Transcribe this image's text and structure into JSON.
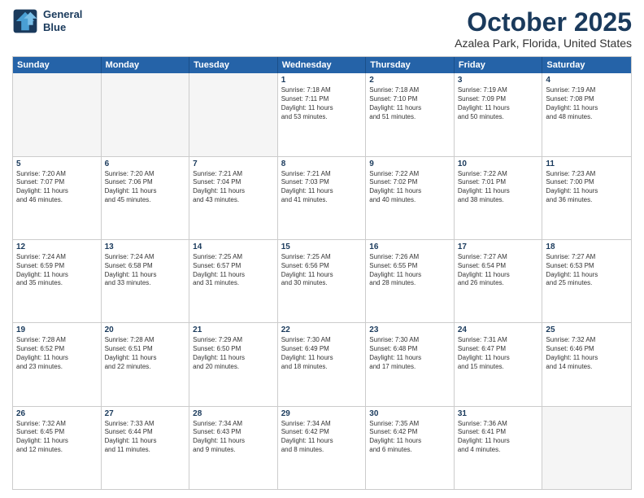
{
  "header": {
    "logo_line1": "General",
    "logo_line2": "Blue",
    "month": "October 2025",
    "location": "Azalea Park, Florida, United States"
  },
  "day_headers": [
    "Sunday",
    "Monday",
    "Tuesday",
    "Wednesday",
    "Thursday",
    "Friday",
    "Saturday"
  ],
  "weeks": [
    [
      {
        "num": "",
        "empty": true,
        "lines": []
      },
      {
        "num": "",
        "empty": true,
        "lines": []
      },
      {
        "num": "",
        "empty": true,
        "lines": []
      },
      {
        "num": "1",
        "empty": false,
        "lines": [
          "Sunrise: 7:18 AM",
          "Sunset: 7:11 PM",
          "Daylight: 11 hours",
          "and 53 minutes."
        ]
      },
      {
        "num": "2",
        "empty": false,
        "lines": [
          "Sunrise: 7:18 AM",
          "Sunset: 7:10 PM",
          "Daylight: 11 hours",
          "and 51 minutes."
        ]
      },
      {
        "num": "3",
        "empty": false,
        "lines": [
          "Sunrise: 7:19 AM",
          "Sunset: 7:09 PM",
          "Daylight: 11 hours",
          "and 50 minutes."
        ]
      },
      {
        "num": "4",
        "empty": false,
        "lines": [
          "Sunrise: 7:19 AM",
          "Sunset: 7:08 PM",
          "Daylight: 11 hours",
          "and 48 minutes."
        ]
      }
    ],
    [
      {
        "num": "5",
        "empty": false,
        "lines": [
          "Sunrise: 7:20 AM",
          "Sunset: 7:07 PM",
          "Daylight: 11 hours",
          "and 46 minutes."
        ]
      },
      {
        "num": "6",
        "empty": false,
        "lines": [
          "Sunrise: 7:20 AM",
          "Sunset: 7:06 PM",
          "Daylight: 11 hours",
          "and 45 minutes."
        ]
      },
      {
        "num": "7",
        "empty": false,
        "lines": [
          "Sunrise: 7:21 AM",
          "Sunset: 7:04 PM",
          "Daylight: 11 hours",
          "and 43 minutes."
        ]
      },
      {
        "num": "8",
        "empty": false,
        "lines": [
          "Sunrise: 7:21 AM",
          "Sunset: 7:03 PM",
          "Daylight: 11 hours",
          "and 41 minutes."
        ]
      },
      {
        "num": "9",
        "empty": false,
        "lines": [
          "Sunrise: 7:22 AM",
          "Sunset: 7:02 PM",
          "Daylight: 11 hours",
          "and 40 minutes."
        ]
      },
      {
        "num": "10",
        "empty": false,
        "lines": [
          "Sunrise: 7:22 AM",
          "Sunset: 7:01 PM",
          "Daylight: 11 hours",
          "and 38 minutes."
        ]
      },
      {
        "num": "11",
        "empty": false,
        "lines": [
          "Sunrise: 7:23 AM",
          "Sunset: 7:00 PM",
          "Daylight: 11 hours",
          "and 36 minutes."
        ]
      }
    ],
    [
      {
        "num": "12",
        "empty": false,
        "lines": [
          "Sunrise: 7:24 AM",
          "Sunset: 6:59 PM",
          "Daylight: 11 hours",
          "and 35 minutes."
        ]
      },
      {
        "num": "13",
        "empty": false,
        "lines": [
          "Sunrise: 7:24 AM",
          "Sunset: 6:58 PM",
          "Daylight: 11 hours",
          "and 33 minutes."
        ]
      },
      {
        "num": "14",
        "empty": false,
        "lines": [
          "Sunrise: 7:25 AM",
          "Sunset: 6:57 PM",
          "Daylight: 11 hours",
          "and 31 minutes."
        ]
      },
      {
        "num": "15",
        "empty": false,
        "lines": [
          "Sunrise: 7:25 AM",
          "Sunset: 6:56 PM",
          "Daylight: 11 hours",
          "and 30 minutes."
        ]
      },
      {
        "num": "16",
        "empty": false,
        "lines": [
          "Sunrise: 7:26 AM",
          "Sunset: 6:55 PM",
          "Daylight: 11 hours",
          "and 28 minutes."
        ]
      },
      {
        "num": "17",
        "empty": false,
        "lines": [
          "Sunrise: 7:27 AM",
          "Sunset: 6:54 PM",
          "Daylight: 11 hours",
          "and 26 minutes."
        ]
      },
      {
        "num": "18",
        "empty": false,
        "lines": [
          "Sunrise: 7:27 AM",
          "Sunset: 6:53 PM",
          "Daylight: 11 hours",
          "and 25 minutes."
        ]
      }
    ],
    [
      {
        "num": "19",
        "empty": false,
        "lines": [
          "Sunrise: 7:28 AM",
          "Sunset: 6:52 PM",
          "Daylight: 11 hours",
          "and 23 minutes."
        ]
      },
      {
        "num": "20",
        "empty": false,
        "lines": [
          "Sunrise: 7:28 AM",
          "Sunset: 6:51 PM",
          "Daylight: 11 hours",
          "and 22 minutes."
        ]
      },
      {
        "num": "21",
        "empty": false,
        "lines": [
          "Sunrise: 7:29 AM",
          "Sunset: 6:50 PM",
          "Daylight: 11 hours",
          "and 20 minutes."
        ]
      },
      {
        "num": "22",
        "empty": false,
        "lines": [
          "Sunrise: 7:30 AM",
          "Sunset: 6:49 PM",
          "Daylight: 11 hours",
          "and 18 minutes."
        ]
      },
      {
        "num": "23",
        "empty": false,
        "lines": [
          "Sunrise: 7:30 AM",
          "Sunset: 6:48 PM",
          "Daylight: 11 hours",
          "and 17 minutes."
        ]
      },
      {
        "num": "24",
        "empty": false,
        "lines": [
          "Sunrise: 7:31 AM",
          "Sunset: 6:47 PM",
          "Daylight: 11 hours",
          "and 15 minutes."
        ]
      },
      {
        "num": "25",
        "empty": false,
        "lines": [
          "Sunrise: 7:32 AM",
          "Sunset: 6:46 PM",
          "Daylight: 11 hours",
          "and 14 minutes."
        ]
      }
    ],
    [
      {
        "num": "26",
        "empty": false,
        "lines": [
          "Sunrise: 7:32 AM",
          "Sunset: 6:45 PM",
          "Daylight: 11 hours",
          "and 12 minutes."
        ]
      },
      {
        "num": "27",
        "empty": false,
        "lines": [
          "Sunrise: 7:33 AM",
          "Sunset: 6:44 PM",
          "Daylight: 11 hours",
          "and 11 minutes."
        ]
      },
      {
        "num": "28",
        "empty": false,
        "lines": [
          "Sunrise: 7:34 AM",
          "Sunset: 6:43 PM",
          "Daylight: 11 hours",
          "and 9 minutes."
        ]
      },
      {
        "num": "29",
        "empty": false,
        "lines": [
          "Sunrise: 7:34 AM",
          "Sunset: 6:42 PM",
          "Daylight: 11 hours",
          "and 8 minutes."
        ]
      },
      {
        "num": "30",
        "empty": false,
        "lines": [
          "Sunrise: 7:35 AM",
          "Sunset: 6:42 PM",
          "Daylight: 11 hours",
          "and 6 minutes."
        ]
      },
      {
        "num": "31",
        "empty": false,
        "lines": [
          "Sunrise: 7:36 AM",
          "Sunset: 6:41 PM",
          "Daylight: 11 hours",
          "and 4 minutes."
        ]
      },
      {
        "num": "",
        "empty": true,
        "lines": []
      }
    ]
  ]
}
